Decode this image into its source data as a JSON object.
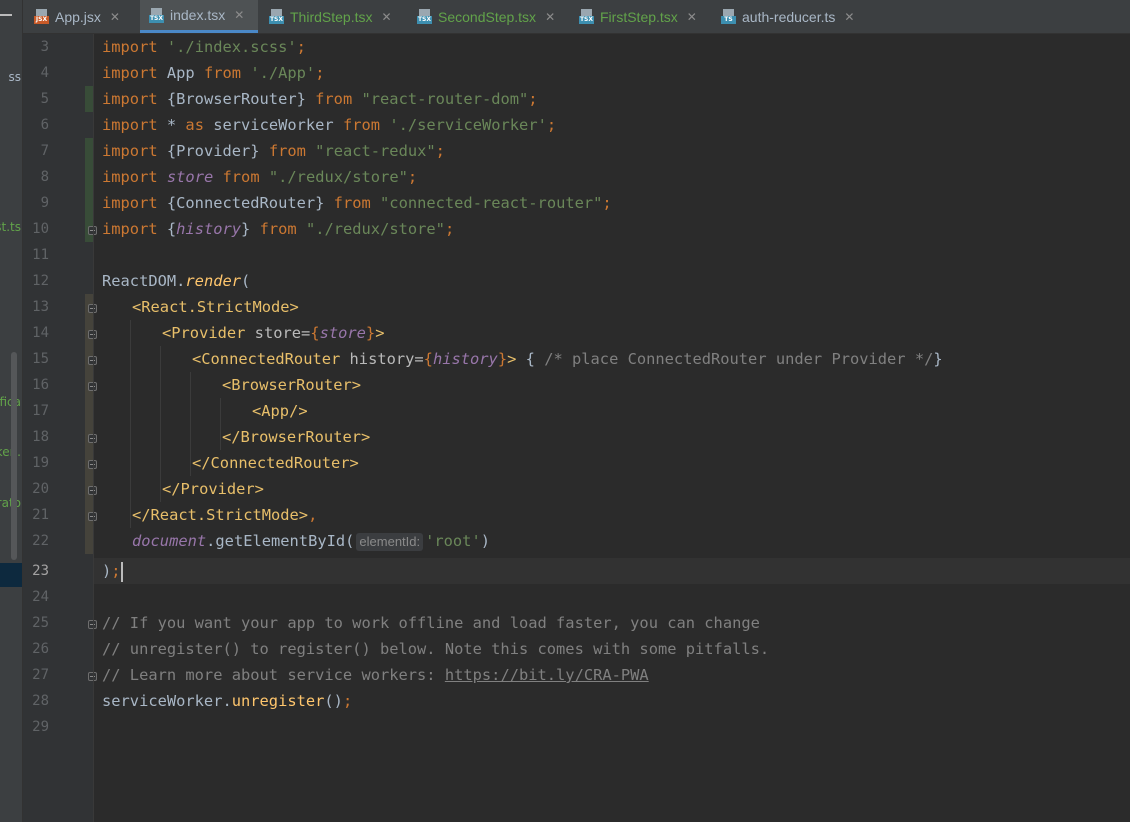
{
  "tabs": [
    {
      "label": "App.jsx",
      "icon": "jsx-file-icon",
      "type_tag": "JSX",
      "tag_color": "#c85a28",
      "text_color": "#a9b7c6"
    },
    {
      "label": "index.tsx",
      "icon": "tsx-file-icon",
      "type_tag": "TSX",
      "tag_color": "#3d8fb0",
      "text_color": "#a9b7c6"
    },
    {
      "label": "ThirdStep.tsx",
      "icon": "tsx-file-icon",
      "type_tag": "TSX",
      "tag_color": "#3d8fb0",
      "text_color": "#62a34a"
    },
    {
      "label": "SecondStep.tsx",
      "icon": "tsx-file-icon",
      "type_tag": "TSX",
      "tag_color": "#3d8fb0",
      "text_color": "#62a34a"
    },
    {
      "label": "FirstStep.tsx",
      "icon": "tsx-file-icon",
      "type_tag": "TSX",
      "tag_color": "#3d8fb0",
      "text_color": "#62a34a"
    },
    {
      "label": "auth-reducer.ts",
      "icon": "ts-file-icon",
      "type_tag": "TS",
      "tag_color": "#3d8fb0",
      "text_color": "#a9b7c6"
    }
  ],
  "sidebar": {
    "fragments": [
      {
        "text": "ss",
        "color": "#a9b7c6"
      },
      {
        "text": "st.ts",
        "color": "#62a34a",
        "selected": true
      },
      {
        "text": "ifica",
        "color": "#62a34a"
      },
      {
        "text": "ken.",
        "color": "#62a34a"
      },
      {
        "text": "erato",
        "color": "#62a34a"
      }
    ]
  },
  "editor": {
    "line_numbers": [
      "3",
      "4",
      "5",
      "6",
      "7",
      "8",
      "9",
      "10",
      "11",
      "12",
      "13",
      "14",
      "15",
      "16",
      "17",
      "18",
      "19",
      "20",
      "21",
      "22",
      "23",
      "24",
      "25",
      "26",
      "27",
      "28",
      "29"
    ],
    "current_line": "23",
    "code": {
      "import": "import",
      "from": "from",
      "as": "as",
      "l3_str": "'./index.scss'",
      "l3_semi": ";",
      "l4_app": " App ",
      "l4_str": "'./App'",
      "l5_name": " {BrowserRouter} ",
      "l5_str": "\"react-router-dom\"",
      "l6_star": " * ",
      "l6_name": " serviceWorker ",
      "l6_str": "'./serviceWorker'",
      "l7_name": " {Provider} ",
      "l7_str": "\"react-redux\"",
      "l8_name": "store",
      "l8_str": "\"./redux/store\"",
      "l9_name": " {ConnectedRouter} ",
      "l9_str": "\"connected-react-router\"",
      "l10_open": " {",
      "l10_name": "history",
      "l10_close": "} ",
      "l10_str": "\"./redux/store\"",
      "l12_obj": "ReactDOM.",
      "l12_fn": "render",
      "l12_paren": "(",
      "l13_tag": "<React.StrictMode>",
      "l14_tag": "<Provider",
      "l14_attr": " store=",
      "l14_open": "{",
      "l14_val": "store",
      "l14_close": "}",
      "l14_end": ">",
      "l15_tag": "<ConnectedRouter",
      "l15_attr": " history=",
      "l15_open": "{",
      "l15_val": "history",
      "l15_close": "}",
      "l15_end": ">",
      "l15_brace_open": " { ",
      "l15_comment": "/* place ConnectedRouter under Provider */",
      "l15_brace_close": "}",
      "l16_tag": "<BrowserRouter>",
      "l17_tag": "<App/>",
      "l18_tag": "</BrowserRouter>",
      "l19_tag": "</ConnectedRouter>",
      "l20_tag": "</Provider>",
      "l21_tag": "</React.StrictMode>",
      "l21_comma": ",",
      "l22_obj": "document",
      "l22_fn": ".getElementById(",
      "l22_hint": "elementId:",
      "l22_str": "'root'",
      "l22_close": ")",
      "l23_paren": ")",
      "l23_semi": ";",
      "l25_comment": "// If you want your app to work offline and load faster, you can change",
      "l26_comment": "// unregister() to register() below. Note this comes with some pitfalls.",
      "l27_comment": "// Learn more about service workers: ",
      "l27_url": "https://bit.ly/CRA-PWA",
      "l28_obj": "serviceWorker.",
      "l28_fn": "unregister",
      "l28_paren": "()",
      "l28_semi": ";"
    }
  }
}
